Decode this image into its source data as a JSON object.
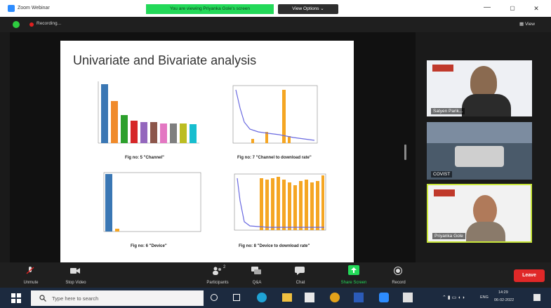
{
  "window": {
    "title": "Zoom Webinar",
    "viewing_banner": "You are viewing Priyanka Gole's screen",
    "view_options": "View Options ⌄",
    "minimize": "—",
    "maximize": "▢",
    "close": "✕"
  },
  "meeting_bar": {
    "recording_label": "Recording...",
    "view_label": "▦ View"
  },
  "slide": {
    "title": "Univariate  and Bivariate analysis",
    "captions": [
      "Fig no: 5 \"Channel\"",
      "Fig no: 7 \"Channel to download rate\"",
      "Fig no: 6 \"Device\"",
      "Fig no: 8 \"Device to download rate\""
    ]
  },
  "participants": [
    {
      "name": "Satyen Parik..."
    },
    {
      "name": "COVIST"
    },
    {
      "name": "Priyanka Gole"
    }
  ],
  "toolbar": {
    "items": [
      {
        "label": "Unmute",
        "icon": "microphone-muted-icon"
      },
      {
        "label": "Stop Video",
        "icon": "video-camera-icon"
      },
      {
        "label": "Participants",
        "icon": "participants-icon",
        "count": "2"
      },
      {
        "label": "Q&A",
        "icon": "qa-icon"
      },
      {
        "label": "Chat",
        "icon": "chat-icon"
      },
      {
        "label": "Share Screen",
        "icon": "share-screen-icon"
      },
      {
        "label": "Record",
        "icon": "record-icon"
      }
    ],
    "leave": "Leave"
  },
  "taskbar": {
    "search_placeholder": "Type here to search",
    "language": "ENG",
    "time": "14:29",
    "date": "06-02-2022"
  },
  "colors": {
    "zoom_green": "#23d959",
    "leave_red": "#e02828",
    "chart_blue": "#3a77b4",
    "chart_orange": "#f5a623"
  }
}
